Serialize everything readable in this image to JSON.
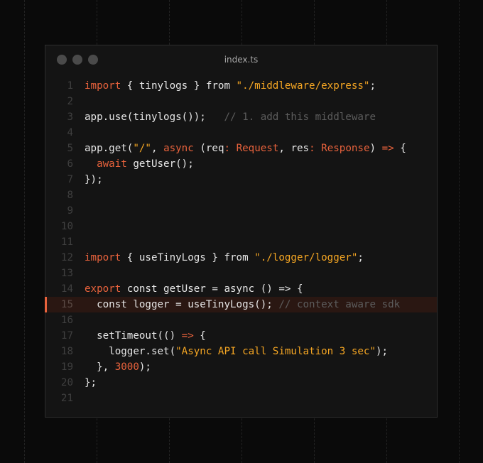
{
  "window": {
    "title": "index.ts"
  },
  "code": {
    "lines": [
      {
        "n": "1",
        "tokens": [
          {
            "t": "import",
            "c": "k"
          },
          {
            "t": " { tinylogs } from ",
            "c": ""
          },
          {
            "t": "\"./middleware/express\"",
            "c": "s"
          },
          {
            "t": ";",
            "c": ""
          }
        ]
      },
      {
        "n": "2",
        "tokens": []
      },
      {
        "n": "3",
        "tokens": [
          {
            "t": "app.use(tinylogs());   ",
            "c": ""
          },
          {
            "t": "// 1. add this middleware",
            "c": "c"
          }
        ]
      },
      {
        "n": "4",
        "tokens": []
      },
      {
        "n": "5",
        "tokens": [
          {
            "t": "app.get(",
            "c": ""
          },
          {
            "t": "\"/\"",
            "c": "s"
          },
          {
            "t": ", ",
            "c": ""
          },
          {
            "t": "async",
            "c": "k"
          },
          {
            "t": " (req",
            "c": ""
          },
          {
            "t": ": Request",
            "c": "t"
          },
          {
            "t": ", res",
            "c": ""
          },
          {
            "t": ": Response",
            "c": "t"
          },
          {
            "t": ") ",
            "c": ""
          },
          {
            "t": "=>",
            "c": "a"
          },
          {
            "t": " {",
            "c": ""
          }
        ]
      },
      {
        "n": "6",
        "tokens": [
          {
            "t": "  ",
            "c": ""
          },
          {
            "t": "await",
            "c": "k"
          },
          {
            "t": " getUser();",
            "c": ""
          }
        ]
      },
      {
        "n": "7",
        "tokens": [
          {
            "t": "});",
            "c": ""
          }
        ]
      },
      {
        "n": "8",
        "tokens": []
      },
      {
        "n": "9",
        "tokens": []
      },
      {
        "n": "10",
        "tokens": []
      },
      {
        "n": "11",
        "tokens": []
      },
      {
        "n": "12",
        "tokens": [
          {
            "t": "import",
            "c": "k"
          },
          {
            "t": " { useTinyLogs } from ",
            "c": ""
          },
          {
            "t": "\"./logger/logger\"",
            "c": "s"
          },
          {
            "t": ";",
            "c": ""
          }
        ]
      },
      {
        "n": "13",
        "tokens": []
      },
      {
        "n": "14",
        "tokens": [
          {
            "t": "export",
            "c": "k"
          },
          {
            "t": " const getUser = async () => {",
            "c": ""
          }
        ]
      },
      {
        "n": "15",
        "highlight": true,
        "tokens": [
          {
            "t": "  const logger = useTinyLogs(); ",
            "c": ""
          },
          {
            "t": "// context aware sdk",
            "c": "c"
          }
        ]
      },
      {
        "n": "16",
        "tokens": []
      },
      {
        "n": "17",
        "tokens": [
          {
            "t": "  setTimeout(() ",
            "c": ""
          },
          {
            "t": "=>",
            "c": "a"
          },
          {
            "t": " {",
            "c": ""
          }
        ]
      },
      {
        "n": "18",
        "tokens": [
          {
            "t": "    logger.set(",
            "c": ""
          },
          {
            "t": "\"Async API call Simulation 3 sec\"",
            "c": "s"
          },
          {
            "t": ");",
            "c": ""
          }
        ]
      },
      {
        "n": "19",
        "tokens": [
          {
            "t": "  }, ",
            "c": ""
          },
          {
            "t": "3000",
            "c": "n"
          },
          {
            "t": ");",
            "c": ""
          }
        ]
      },
      {
        "n": "20",
        "tokens": [
          {
            "t": "};",
            "c": ""
          }
        ]
      },
      {
        "n": "21",
        "tokens": []
      }
    ]
  },
  "colors": {
    "background": "#0a0a0a",
    "window": "#141414",
    "keyword": "#e8623c",
    "string": "#f5a623",
    "comment": "#5c5c5c",
    "highlight": "#2a1712"
  }
}
